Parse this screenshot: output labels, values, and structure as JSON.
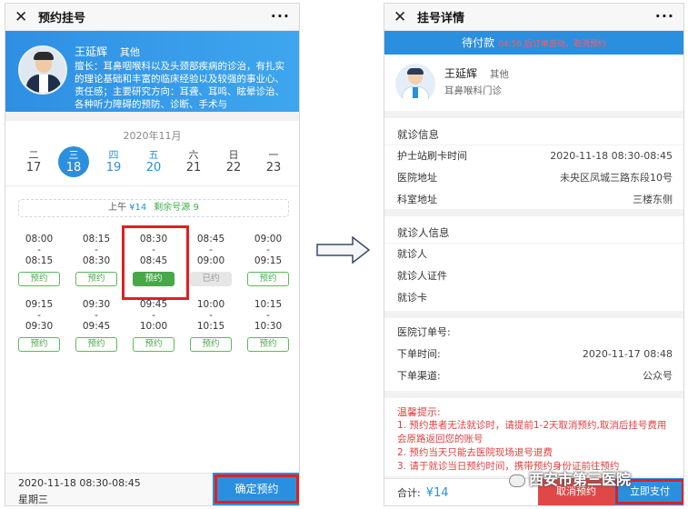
{
  "left": {
    "title": "预约挂号",
    "close": "✕",
    "more": "···",
    "doctor": {
      "name": "王延辉",
      "level": "其他",
      "intro": "擅长：耳鼻咽喉科以及头颈部疾病的诊治，有扎实的理论基础和丰富的临床经验以及较强的事业心、责任感；主要研究方向：耳聋、耳鸣、眩晕诊治、各种听力障碍的预防、诊断、手术与"
    },
    "month": "2020年11月",
    "days": [
      {
        "week": "二",
        "date": "17",
        "state": "normal"
      },
      {
        "week": "三",
        "date": "18",
        "state": "selected"
      },
      {
        "week": "四",
        "date": "19",
        "state": "blue"
      },
      {
        "week": "五",
        "date": "20",
        "state": "blue"
      },
      {
        "week": "六",
        "date": "21",
        "state": "normal"
      },
      {
        "week": "日",
        "date": "22",
        "state": "normal"
      },
      {
        "week": "一",
        "date": "23",
        "state": "normal"
      }
    ],
    "session": {
      "label": "上午",
      "fee": "¥14",
      "remain": "剩余号源 9"
    },
    "slots": [
      [
        {
          "start": "08:00",
          "end": "08:15",
          "btn": "预约",
          "state": "open"
        },
        {
          "start": "08:15",
          "end": "08:30",
          "btn": "预约",
          "state": "open"
        },
        {
          "start": "08:30",
          "end": "08:45",
          "btn": "预约",
          "state": "selected"
        },
        {
          "start": "08:45",
          "end": "09:00",
          "btn": "已约",
          "state": "taken"
        },
        {
          "start": "09:00",
          "end": "09:15",
          "btn": "预约",
          "state": "open"
        }
      ],
      [
        {
          "start": "09:15",
          "end": "09:30",
          "btn": "预约",
          "state": "open"
        },
        {
          "start": "09:30",
          "end": "09:45",
          "btn": "预约",
          "state": "open"
        },
        {
          "start": "09:45",
          "end": "10:00",
          "btn": "预约",
          "state": "open"
        },
        {
          "start": "10:00",
          "end": "10:15",
          "btn": "预约",
          "state": "open"
        },
        {
          "start": "10:15",
          "end": "10:30",
          "btn": "预约",
          "state": "open"
        }
      ]
    ],
    "dash": "-",
    "footer": {
      "datetime": "2020-11-18  08:30-08:45",
      "weekday": "星期三",
      "confirm": "确定预约"
    }
  },
  "right": {
    "title": "挂号详情",
    "close": "✕",
    "more": "···",
    "status": "待付款",
    "status_note": "04:56 后订单自动，取消预约",
    "doctor": {
      "name": "王延辉",
      "level": "其他",
      "dept": "耳鼻喉科门诊"
    },
    "visit_info": {
      "title": "就诊信息",
      "rows": [
        {
          "k": "护士站刷卡时间",
          "v": "2020-11-18 08:30-08:45"
        },
        {
          "k": "医院地址",
          "v": "未央区凤城三路东段10号"
        },
        {
          "k": "科室地址",
          "v": "三楼东侧"
        }
      ]
    },
    "patient_info": {
      "title": "就诊人信息",
      "rows": [
        {
          "k": "就诊人",
          "v": ""
        },
        {
          "k": "就诊人证件",
          "v": ""
        },
        {
          "k": "就诊卡",
          "v": ""
        }
      ]
    },
    "order_info": {
      "rows": [
        {
          "k": "医院订单号:",
          "v": ""
        },
        {
          "k": "下单时间:",
          "v": "2020-11-17 08:48"
        },
        {
          "k": "下单渠道:",
          "v": "公众号"
        }
      ]
    },
    "tips": {
      "title": "温馨提示:",
      "items": [
        "1. 预约患者无法就诊时，请提前1-2天取消预约,取消后挂号费用会原路返回您的账号",
        "2. 预约当天只能去医院现场退号退费",
        "3. 请于就诊当日预约时间，携带预约身份证前往预约"
      ]
    },
    "footer": {
      "total_label": "合计:",
      "total": "¥14",
      "cancel": "取消预约",
      "pay": "立即支付"
    }
  },
  "watermark": "西安市第三医院",
  "colors": {
    "primary": "#2b8fe0",
    "green": "#46a846",
    "red": "#e02020"
  }
}
